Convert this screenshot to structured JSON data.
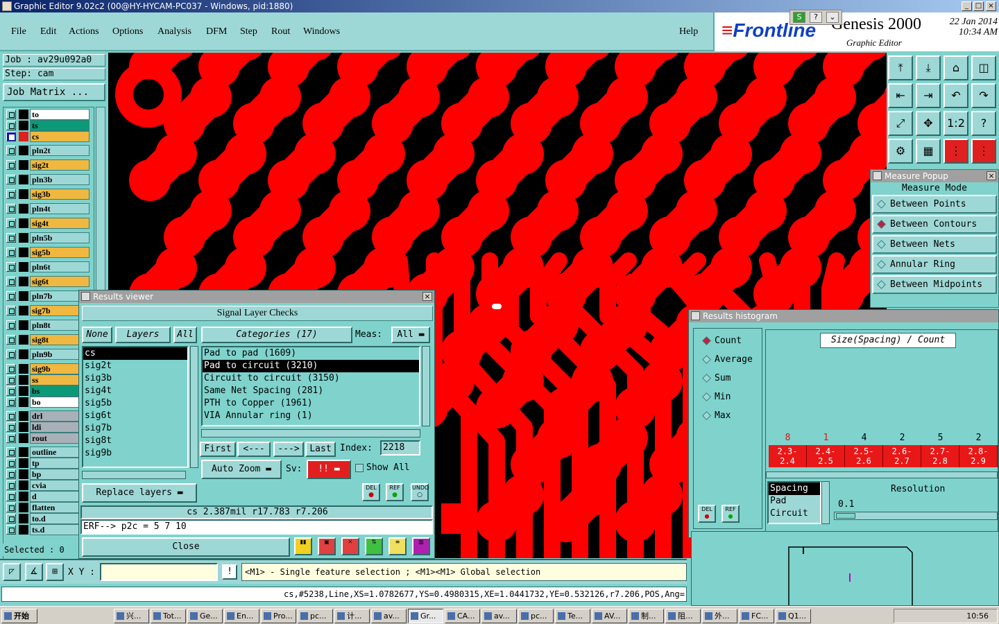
{
  "window": {
    "title": "Graphic Editor 9.02c2 (00@HY-HYCAM-PC037 - Windows, pid:1880)",
    "controls": [
      "_",
      "□",
      "×"
    ]
  },
  "menu": {
    "items": [
      "File",
      "Edit",
      "Actions",
      "Options",
      "Analysis",
      "DFM",
      "Step",
      "Rout",
      "Windows"
    ],
    "help": "Help"
  },
  "brand": {
    "logo": "Frontline",
    "product": "Genesis 2000",
    "subtitle": "Graphic Editor",
    "date": "22 Jan 2014",
    "time": "10:34 AM"
  },
  "leftpanel": {
    "job": "Job : av29u092a0",
    "step": "Step: cam",
    "job_matrix": "Job Matrix ...",
    "selected": "Selected : 0",
    "layers": [
      {
        "name": "to",
        "color": "#ffffff",
        "swatch": "#000000",
        "active": false
      },
      {
        "name": "ts",
        "color": "#0a9a78",
        "swatch": "#000000",
        "active": false
      },
      {
        "name": "cs",
        "color": "#f0b840",
        "swatch": "#e02020",
        "active": true
      },
      {
        "name": "pln2t",
        "color": "#9ed8d6",
        "swatch": "#000000",
        "active": false
      },
      {
        "name": "sig2t",
        "color": "#f0b840",
        "swatch": "#000000",
        "active": false
      },
      {
        "name": "pln3b",
        "color": "#9ed8d6",
        "swatch": "#000000",
        "active": false
      },
      {
        "name": "sig3b",
        "color": "#f0b840",
        "swatch": "#000000",
        "active": false
      },
      {
        "name": "pln4t",
        "color": "#9ed8d6",
        "swatch": "#000000",
        "active": false
      },
      {
        "name": "sig4t",
        "color": "#f0b840",
        "swatch": "#000000",
        "active": false
      },
      {
        "name": "pln5b",
        "color": "#9ed8d6",
        "swatch": "#000000",
        "active": false
      },
      {
        "name": "sig5b",
        "color": "#f0b840",
        "swatch": "#000000",
        "active": false
      },
      {
        "name": "pln6t",
        "color": "#9ed8d6",
        "swatch": "#000000",
        "active": false
      },
      {
        "name": "sig6t",
        "color": "#f0b840",
        "swatch": "#000000",
        "active": false
      },
      {
        "name": "pln7b",
        "color": "#9ed8d6",
        "swatch": "#000000",
        "active": false
      },
      {
        "name": "sig7b",
        "color": "#f0b840",
        "swatch": "#000000",
        "active": false
      },
      {
        "name": "pln8t",
        "color": "#9ed8d6",
        "swatch": "#000000",
        "active": false
      },
      {
        "name": "sig8t",
        "color": "#f0b840",
        "swatch": "#000000",
        "active": false
      },
      {
        "name": "pln9b",
        "color": "#9ed8d6",
        "swatch": "#000000",
        "active": false
      },
      {
        "name": "sig9b",
        "color": "#f0b840",
        "swatch": "#000000",
        "active": false
      },
      {
        "name": "ss",
        "color": "#f0b840",
        "swatch": "#000000",
        "active": false
      },
      {
        "name": "bs",
        "color": "#0a9a78",
        "swatch": "#000000",
        "active": false
      },
      {
        "name": "bo",
        "color": "#ffffff",
        "swatch": "#000000",
        "active": false
      },
      {
        "name": "drl",
        "color": "#a8b0b8",
        "swatch": "#000000",
        "active": false
      },
      {
        "name": "ldi",
        "color": "#a8b0b8",
        "swatch": "#000000",
        "active": false
      },
      {
        "name": "rout",
        "color": "#a8b0b8",
        "swatch": "#000000",
        "active": false
      },
      {
        "name": "outline",
        "color": "#9ed8d6",
        "swatch": "#000000",
        "active": false
      },
      {
        "name": "tp",
        "color": "#9ed8d6",
        "swatch": "#000000",
        "active": false
      },
      {
        "name": "bp",
        "color": "#9ed8d6",
        "swatch": "#000000",
        "active": false
      },
      {
        "name": "cvia",
        "color": "#9ed8d6",
        "swatch": "#000000",
        "active": false
      },
      {
        "name": "d",
        "color": "#9ed8d6",
        "swatch": "#000000",
        "active": false
      },
      {
        "name": "flatten",
        "color": "#9ed8d6",
        "swatch": "#000000",
        "active": false
      },
      {
        "name": "to.d",
        "color": "#9ed8d6",
        "swatch": "#000000",
        "active": false
      },
      {
        "name": "ts.d",
        "color": "#9ed8d6",
        "swatch": "#000000",
        "active": false
      }
    ]
  },
  "toolbox": {
    "icons": [
      "home-up-icon",
      "pan-down-icon",
      "house-icon",
      "split-view-icon",
      "pan-left-icon",
      "pan-right-icon",
      "undo-view-icon",
      "redo-view-icon",
      "zoom-fit-icon",
      "zoom-center-icon",
      "zoom-one-to-one-icon",
      "help-icon",
      "settings-icon",
      "grid-icon",
      "snap-a-icon",
      "snap-b-icon"
    ],
    "one_to_one": "1:2",
    "help": "?"
  },
  "measure": {
    "title": "Measure Popup",
    "heading": "Measure Mode",
    "options": [
      {
        "label": "Between Points",
        "on": false
      },
      {
        "label": "Between Contours",
        "on": true
      },
      {
        "label": "Between Nets",
        "on": false
      },
      {
        "label": "Annular Ring",
        "on": false
      },
      {
        "label": "Between Midpoints",
        "on": false
      }
    ]
  },
  "results_viewer": {
    "title": "Results viewer",
    "heading": "Signal Layer Checks",
    "none": "None",
    "layers_label": "Layers",
    "all": "All",
    "categories": "Categories (17)",
    "meas_label": "Meas:",
    "meas_value": "All",
    "layers": [
      "cs",
      "sig2t",
      "sig3b",
      "sig4t",
      "sig5b",
      "sig6t",
      "sig7b",
      "sig8t",
      "sig9b"
    ],
    "checks": [
      {
        "label": "Pad to pad (1609)",
        "sel": false
      },
      {
        "label": "Pad to circuit (3210)",
        "sel": true
      },
      {
        "label": "Circuit to circuit (3150)",
        "sel": false
      },
      {
        "label": "Same Net Spacing (281)",
        "sel": false
      },
      {
        "label": "PTH to Copper (1961)",
        "sel": false
      },
      {
        "label": "VIA Annular ring (1)",
        "sel": false
      }
    ],
    "first": "First",
    "prev": "<---",
    "next": "--->",
    "last": "Last",
    "index_label": "Index:",
    "index_value": "2218",
    "auto_zoom": "Auto Zoom",
    "sv_label": "Sv:",
    "sv_value": "!!",
    "show_all": "Show All",
    "replace_layers": "Replace layers",
    "del": "DEL",
    "ref": "REF",
    "undo": "UNDO",
    "info": "cs 2.387mil   r17.783   r7.206",
    "erf": "ERF--> p2c = 5 7 10",
    "close": "Close"
  },
  "histogram": {
    "title": "Results histogram",
    "options": [
      {
        "label": "Count",
        "on": true
      },
      {
        "label": "Average",
        "on": false
      },
      {
        "label": "Sum",
        "on": false
      },
      {
        "label": "Min",
        "on": false
      },
      {
        "label": "Max",
        "on": false
      }
    ],
    "header": "Size(Spacing) / Count",
    "counts": [
      "8",
      "1",
      "4",
      "2",
      "5",
      "2"
    ],
    "bins": [
      {
        "a": "2.3-",
        "b": "2.4"
      },
      {
        "a": "2.4-",
        "b": "2.5"
      },
      {
        "a": "2.5-",
        "b": "2.6"
      },
      {
        "a": "2.6-",
        "b": "2.7"
      },
      {
        "a": "2.7-",
        "b": "2.8"
      },
      {
        "a": "2.8-",
        "b": "2.9"
      }
    ],
    "types": [
      "Spacing",
      "Pad",
      "Circuit"
    ],
    "resolution_label": "Resolution",
    "resolution_value": "0.1",
    "del": "DEL",
    "ref": "REF"
  },
  "coordbar": {
    "xy_label": "X Y :",
    "xy_value": "",
    "hint": "<M1> - Single feature selection ; <M1><M1> Global selection",
    "excl": "!"
  },
  "status": {
    "line": "cs,#5238,Line,XS=1.0782677,YS=0.4980315,XE=1.0441732,YE=0.532126,r7.206,POS,Ang="
  },
  "taskbar": {
    "start": "开始",
    "tasks": [
      "兴...",
      "Tot...",
      "Ge...",
      "En...",
      "Pro...",
      "pc...",
      "计...",
      "av...",
      "Gr...",
      "CA...",
      "av...",
      "pc...",
      "Te...",
      "AV...",
      "制...",
      "阻...",
      "外...",
      "FC...",
      "Q1..."
    ],
    "active_task": 8,
    "clock": "10:56"
  }
}
